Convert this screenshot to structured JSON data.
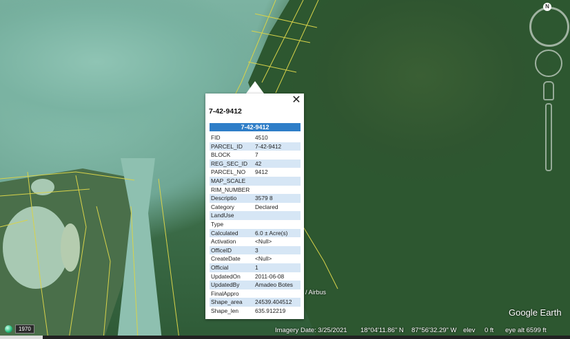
{
  "popup": {
    "title": "7-42-9412",
    "header": "7-42-9412",
    "close_label": "✕",
    "attributes": [
      {
        "key": "FID",
        "value": "4510"
      },
      {
        "key": "PARCEL_ID",
        "value": "7-42-9412"
      },
      {
        "key": "BLOCK",
        "value": "7"
      },
      {
        "key": "REG_SEC_ID",
        "value": "42"
      },
      {
        "key": "PARCEL_NO",
        "value": "9412"
      },
      {
        "key": "MAP_SCALE",
        "value": ""
      },
      {
        "key": "RIM_NUMBER",
        "value": ""
      },
      {
        "key": "Descriptio",
        "value": "3579 8"
      },
      {
        "key": "Category",
        "value": "Declared"
      },
      {
        "key": "LandUse",
        "value": ""
      },
      {
        "key": "Type",
        "value": ""
      },
      {
        "key": "Calculated",
        "value": "6.0 ± Acre(s)"
      },
      {
        "key": "Activation",
        "value": "<Null>"
      },
      {
        "key": "OfficeID",
        "value": "3"
      },
      {
        "key": "CreateDate",
        "value": "<Null>"
      },
      {
        "key": "Official",
        "value": "1"
      },
      {
        "key": "UpdatedOn",
        "value": "2011-06-08"
      },
      {
        "key": "UpdatedBy",
        "value": "Amadeo Botes"
      },
      {
        "key": "FinalAppro",
        "value": ""
      },
      {
        "key": "Shape_area",
        "value": "24539.404512"
      },
      {
        "key": "Shape_len",
        "value": "635.912219"
      }
    ]
  },
  "status": {
    "year": "1970",
    "imagery_date": "Imagery Date: 3/25/2021",
    "lat": "18°04'11.86\" N",
    "lon": "87°56'32.29\" W",
    "elev_label": "elev",
    "elev_value": "0 ft",
    "eye_alt": "eye alt  6599 ft"
  },
  "overlay": {
    "logo": "Google Earth",
    "airbus": "/ Airbus",
    "compass_n": "N"
  }
}
